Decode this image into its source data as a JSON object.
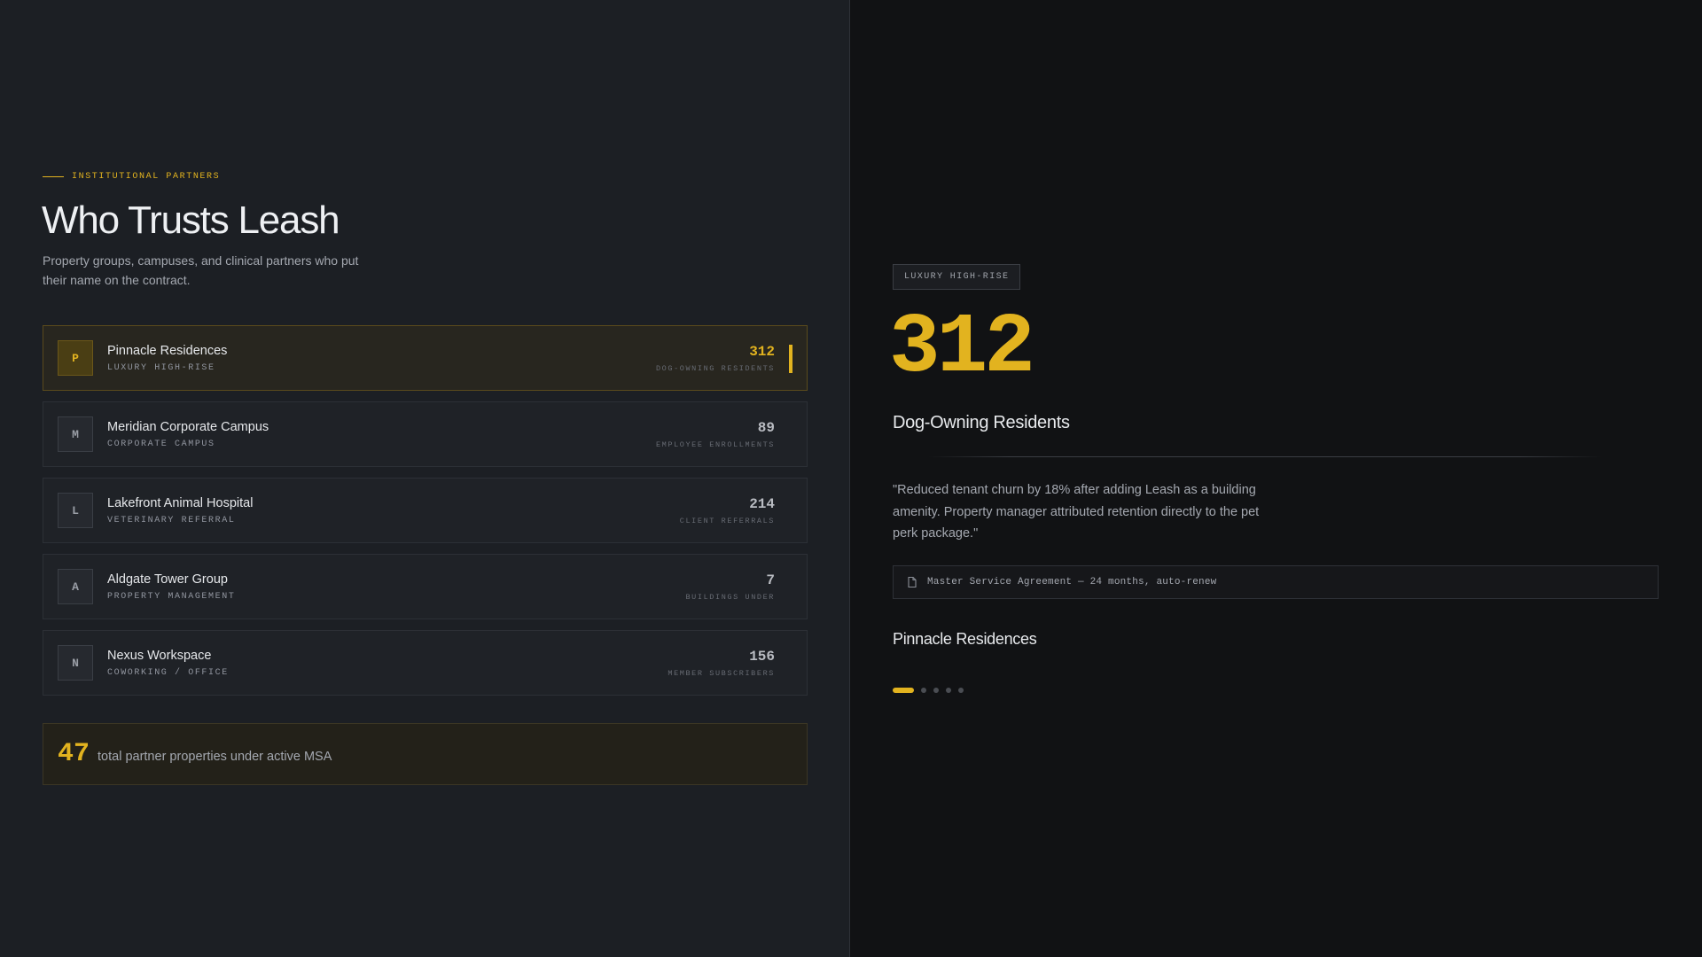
{
  "header": {
    "eyebrow": "INSTITUTIONAL PARTNERS",
    "title": "Who Trusts Leash",
    "subtitle": "Property groups, campuses, and clinical partners who put their name on the contract."
  },
  "partners": [
    {
      "initial": "P",
      "name": "Pinnacle Residences",
      "type": "LUXURY HIGH-RISE",
      "metric": "312",
      "metric_label": "DOG-OWNING RESIDENTS"
    },
    {
      "initial": "M",
      "name": "Meridian Corporate Campus",
      "type": "CORPORATE CAMPUS",
      "metric": "89",
      "metric_label": "EMPLOYEE ENROLLMENTS"
    },
    {
      "initial": "L",
      "name": "Lakefront Animal Hospital",
      "type": "VETERINARY REFERRAL",
      "metric": "214",
      "metric_label": "CLIENT REFERRALS"
    },
    {
      "initial": "A",
      "name": "Aldgate Tower Group",
      "type": "PROPERTY MANAGEMENT",
      "metric": "7",
      "metric_label": "BUILDINGS UNDER"
    },
    {
      "initial": "N",
      "name": "Nexus Workspace",
      "type": "COWORKING / OFFICE",
      "metric": "156",
      "metric_label": "MEMBER SUBSCRIBERS"
    }
  ],
  "total": {
    "number": "47",
    "text": "total partner properties under active MSA"
  },
  "detail": {
    "tag": "LUXURY HIGH-RISE",
    "big_number": "312",
    "metric_label": "Dog-Owning Residents",
    "quote": "\"Reduced tenant churn by 18% after adding Leash as a building amenity. Property manager attributed retention directly to the pet perk package.\"",
    "contract": "Master Service Agreement — 24 months, auto-renew",
    "partner_name": "Pinnacle Residences",
    "active_index": 0,
    "dot_count": 5
  },
  "colors": {
    "accent": "#e2b31f",
    "left_bg": "#1c1f24",
    "right_bg": "#111214"
  },
  "icons": {
    "contract": "document-icon"
  }
}
